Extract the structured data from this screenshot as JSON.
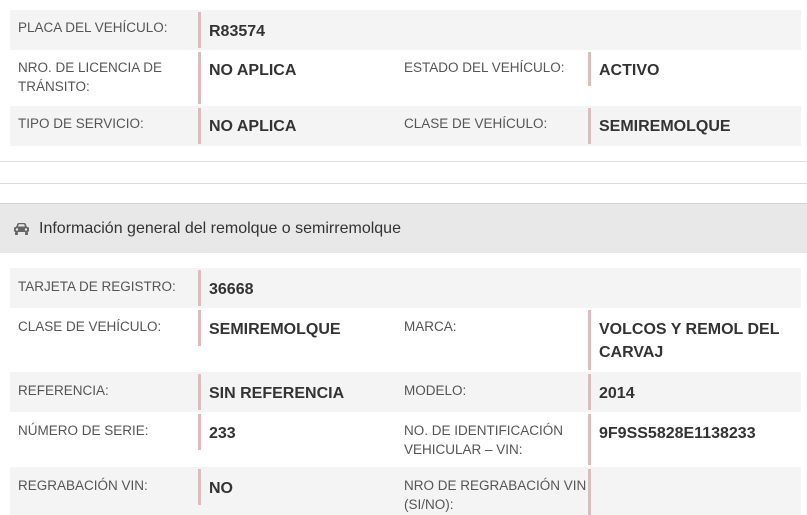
{
  "top_table": {
    "rows": [
      {
        "label_a": "PLACA DEL VEHÍCULO:",
        "value_a": "R83574"
      },
      {
        "label_a": "NRO. DE LICENCIA DE TRÁNSITO:",
        "value_a": "NO APLICA",
        "label_b": "ESTADO DEL VEHÍCULO:",
        "value_b": "ACTIVO"
      },
      {
        "label_a": "TIPO DE SERVICIO:",
        "value_a": "NO APLICA",
        "label_b": "CLASE DE VEHÍCULO:",
        "value_b": "SEMIREMOLQUE"
      }
    ]
  },
  "section": {
    "icon": "car-icon",
    "title": "Información general del remolque o semirremolque"
  },
  "trailer_table": {
    "rows": [
      {
        "label_a": "TARJETA DE REGISTRO:",
        "value_a": "36668"
      },
      {
        "label_a": "CLASE DE VEHÍCULO:",
        "value_a": "SEMIREMOLQUE",
        "label_b": "MARCA:",
        "value_b": "VOLCOS Y REMOL DEL CARVAJ"
      },
      {
        "label_a": "REFERENCIA:",
        "value_a": "SIN REFERENCIA",
        "label_b": "MODELO:",
        "value_b": "2014"
      },
      {
        "label_a": "NÚMERO DE SERIE:",
        "value_a": "233",
        "label_b": "NO. DE IDENTIFICACIÓN VEHICULAR – VIN:",
        "value_b": "9F9SS5828E1138233"
      },
      {
        "label_a": "REGRABACIÓN VIN:",
        "value_a": "NO",
        "label_b": "NRO DE REGRABACIÓN VIN (SI/NO):",
        "value_b": ""
      }
    ]
  }
}
